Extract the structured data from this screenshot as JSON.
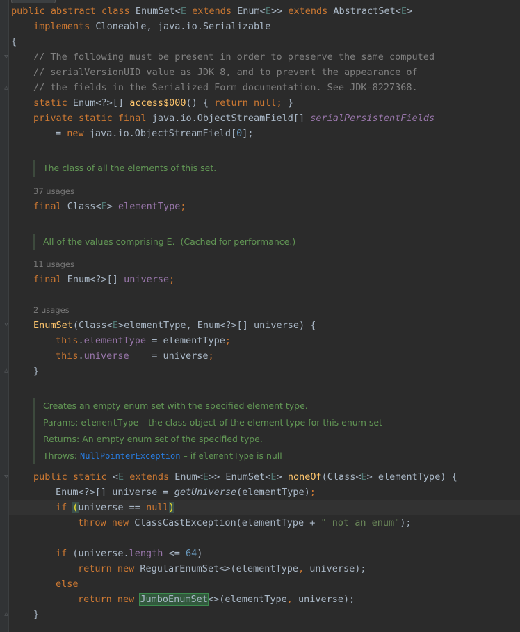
{
  "editor": {
    "class_decl": {
      "mod": "public abstract class ",
      "name": "EnumSet",
      "lt": "<",
      "g": "E",
      "ext": " extends ",
      "enum": "Enum",
      "gclose": ">> ",
      "ext2": "extends ",
      "sup": "AbstractSet",
      "lt2": "<",
      "g2": "E",
      "gt2": ">"
    },
    "implements": {
      "kw": "implements ",
      "rest": "Cloneable, java.io.Serializable"
    },
    "open_brace": "{",
    "comments": [
      "// The following must be present in order to preserve the same computed",
      "// serialVersionUID value as JDK 8, and to prevent the appearance of",
      "// the fields in the Serialized Form documentation. See JDK-8227368."
    ],
    "access": {
      "kw": "static ",
      "type": "Enum<?>[] ",
      "name": "access$000",
      "paren": "() { ",
      "ret": "return null; ",
      "close": "}"
    },
    "spf": {
      "kw": "private static final ",
      "type": "java.io.ObjectStreamField[] ",
      "name": "serialPersistentFields"
    },
    "spf2": {
      "eq": "= ",
      "kw": "new ",
      "type": "java.io.ObjectStreamField[",
      "num": "0",
      "end": "];"
    },
    "doc1": "The class of all the elements of this set.",
    "usage1": "37 usages",
    "elementType": {
      "kw": "final ",
      "type": "Class<",
      "g": "E",
      "gt": "> ",
      "name": "elementType",
      "semi": ";"
    },
    "doc2": "All of the values comprising E.  (Cached for performance.)",
    "usage2": "11 usages",
    "universe": {
      "kw": "final ",
      "type": "Enum<?>[] ",
      "name": "universe",
      "semi": ";"
    },
    "usage3": "2 usages",
    "ctor": {
      "name": "EnumSet",
      "p1": "(Class<",
      "g": "E",
      "p2": ">elementType, Enum<?>[] universe) {"
    },
    "ctor_l1": {
      "this": "this",
      "dot": ".",
      "field": "elementType",
      "rest": " = elementType",
      "semi": ";"
    },
    "ctor_l2": {
      "this": "this",
      "dot": ".",
      "field": "universe",
      "rest": "    = universe",
      "semi": ";"
    },
    "close_brace": "}",
    "doc3": {
      "l1": "Creates an empty enum set with the specified element type.",
      "params_label": "Params: ",
      "params_name": "elementType",
      "params_text": " – the class object of the element type for this enum set",
      "returns": "Returns: An empty enum set of the specified type.",
      "throws_label": "Throws: ",
      "throws_link": "NullPointerException",
      "throws_text1": " – if ",
      "throws_code": "elementType",
      "throws_text2": " is null"
    },
    "noneOf": {
      "kw": "public static ",
      "lt": "<",
      "g": "E",
      "ext": " extends ",
      "enum": "Enum<",
      "g2": "E",
      "t2": ">> EnumSet<",
      "g3": "E",
      "t3": "> ",
      "name": "noneOf",
      "p1": "(Class<",
      "g4": "E",
      "p2": "> elementType) {"
    },
    "n1": {
      "type": "Enum<?>[] universe = ",
      "call": "getUniverse",
      "args": "(elementType)",
      "semi": ";"
    },
    "n2": {
      "kw": "if ",
      "lp": "(",
      "cond": "universe == ",
      "null": "null",
      "rp": ")"
    },
    "n3": {
      "kw": "throw new ",
      "cls": "ClassCastException(elementType + ",
      "str": "\" not an enum\"",
      "end": ");"
    },
    "n4": {
      "kw": "if ",
      "p1": "(universe.",
      "field": "length",
      "op": " <= ",
      "num": "64",
      "p2": ")"
    },
    "n5": {
      "kw": "return new ",
      "cls": "RegularEnumSet<>(elementType",
      "comma": ", ",
      "arg": "universe",
      "end": ");"
    },
    "n6": {
      "kw": "else"
    },
    "n7": {
      "kw": "return new ",
      "cls": "JumboEnumSet",
      "rest": "<>(elementType",
      "comma": ", ",
      "arg": "universe",
      "end": ");"
    }
  }
}
